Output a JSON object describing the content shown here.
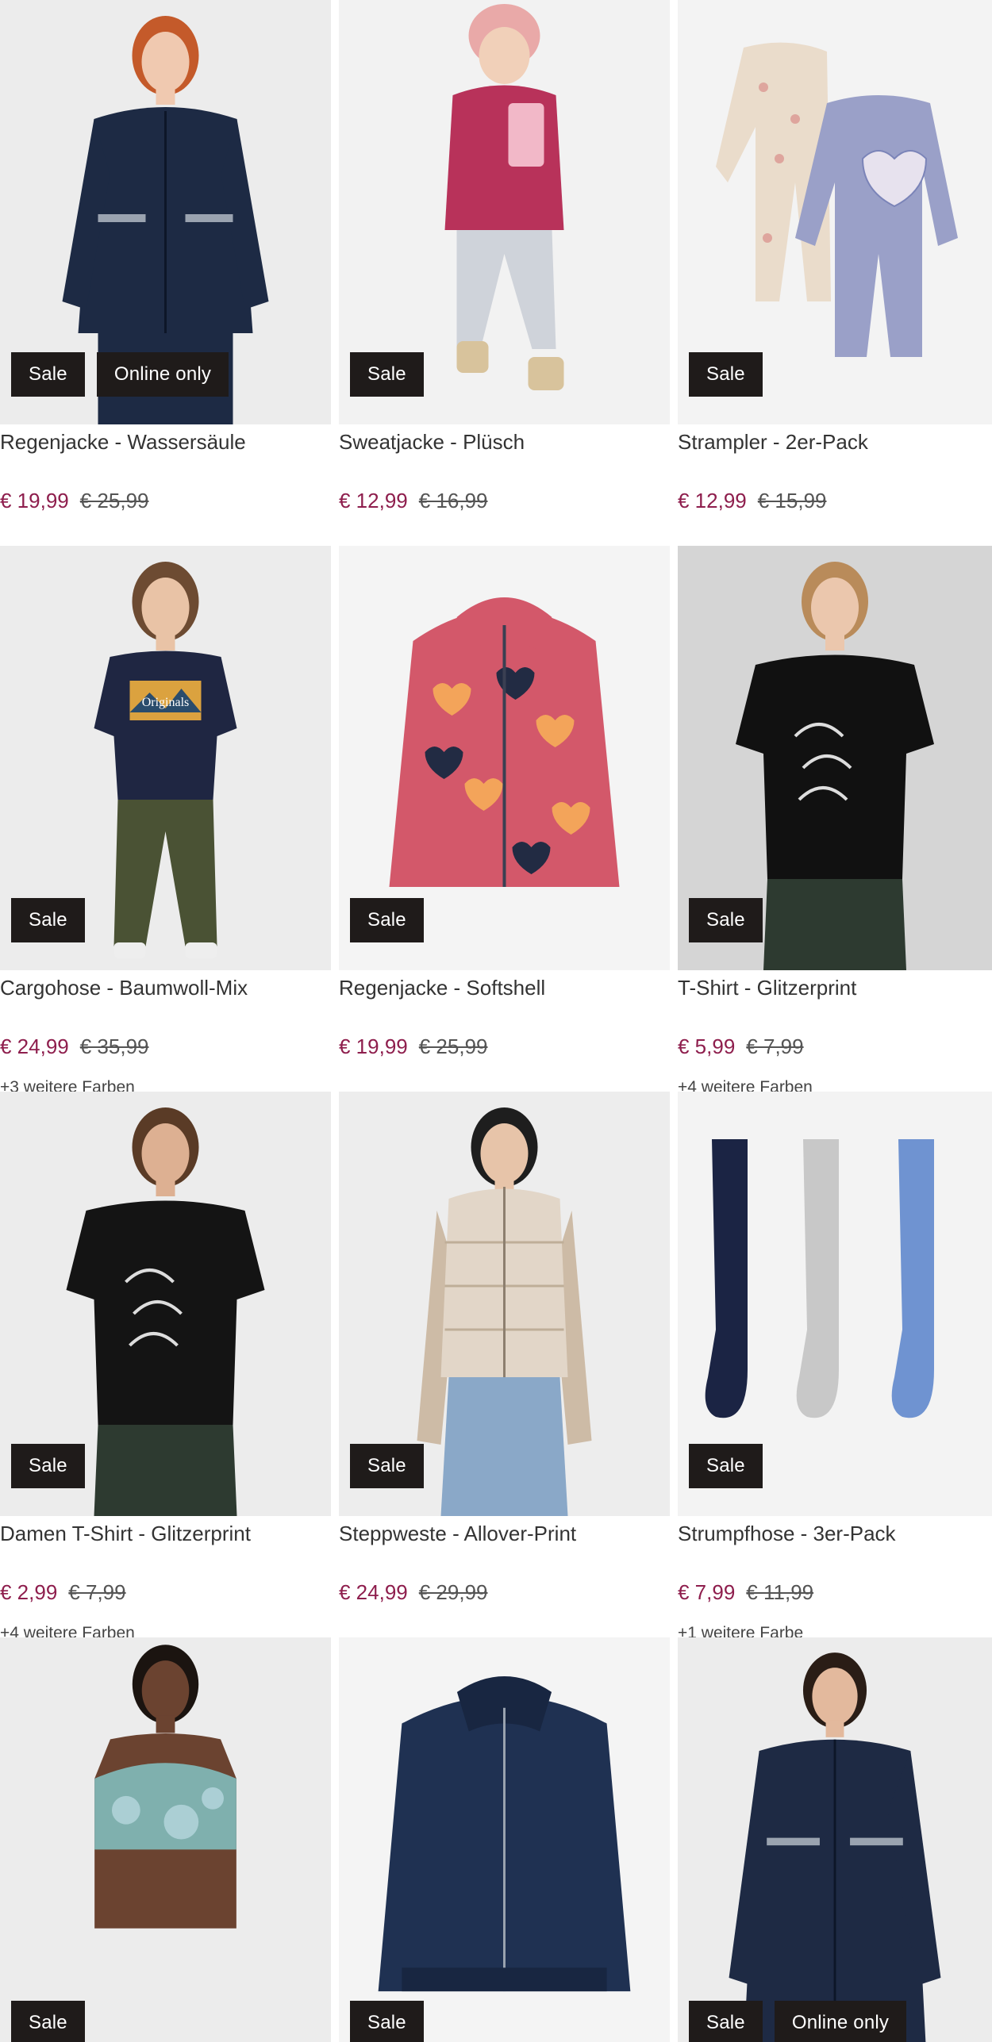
{
  "products": [
    {
      "name": "Regenjacke - Wassersäule",
      "price": "€ 19,99",
      "old_price": "€ 25,99",
      "colors": "",
      "badges": [
        "Sale",
        "Online only"
      ],
      "bg": "#ececec",
      "garment": "#1d2a44",
      "skin": "#f0c9b0",
      "hair": "#c45a2a"
    },
    {
      "name": "Sweatjacke - Plüsch",
      "price": "€ 12,99",
      "old_price": "€ 16,99",
      "colors": "",
      "badges": [
        "Sale"
      ],
      "bg": "#f2f2f2",
      "garment": "#b8325a",
      "skin": "#f1d0b9",
      "hair": "#d7a24f"
    },
    {
      "name": "Strampler - 2er-Pack",
      "price": "€ 12,99",
      "old_price": "€ 15,99",
      "colors": "",
      "badges": [
        "Sale"
      ],
      "bg": "#f3f3f3",
      "garment": "#9aa0c8",
      "skin": "#e8d7c6",
      "hair": "#e8d7c6"
    },
    {
      "name": "Cargohose - Baumwoll-Mix",
      "price": "€ 24,99",
      "old_price": "€ 35,99",
      "colors": "+3 weitere Farben",
      "badges": [
        "Sale"
      ],
      "bg": "#ececec",
      "garment": "#4a5234",
      "skin": "#e9c3a6",
      "hair": "#6d4b32"
    },
    {
      "name": "Regenjacke - Softshell",
      "price": "€ 19,99",
      "old_price": "€ 25,99",
      "colors": "",
      "badges": [
        "Sale"
      ],
      "bg": "#f4f4f4",
      "garment": "#d3586a",
      "skin": "#f3a45a",
      "hair": "#222b43"
    },
    {
      "name": "T-Shirt - Glitzerprint",
      "price": "€ 5,99",
      "old_price": "€ 7,99",
      "colors": "+4 weitere Farben",
      "badges": [
        "Sale"
      ],
      "bg": "#d5d5d5",
      "garment": "#111111",
      "skin": "#ebc7ad",
      "hair": "#b98b5a"
    },
    {
      "name": "Damen T-Shirt - Glitzerprint",
      "price": "€ 2,99",
      "old_price": "€ 7,99",
      "colors": "+4 weitere Farben",
      "badges": [
        "Sale"
      ],
      "bg": "#ececec",
      "garment": "#141414",
      "skin": "#ddb092",
      "hair": "#5a3b26"
    },
    {
      "name": "Steppweste - Allover-Print",
      "price": "€ 24,99",
      "old_price": "€ 29,99",
      "colors": "",
      "badges": [
        "Sale"
      ],
      "bg": "#ededed",
      "garment": "#e2d6c8",
      "skin": "#e7c4a9",
      "hair": "#1e1e1e"
    },
    {
      "name": "Strumpfhose - 3er-Pack",
      "price": "€ 7,99",
      "old_price": "€ 11,99",
      "colors": "+1 weitere Farbe",
      "badges": [
        "Sale"
      ],
      "bg": "#f3f3f3",
      "garment": "#1b2444",
      "skin": "#c8c8c8",
      "hair": "#6f93d1"
    },
    {
      "name": "",
      "price": "",
      "old_price": "",
      "colors": "",
      "badges": [
        "Sale"
      ],
      "bg": "#ececec",
      "garment": "#7fb0ae",
      "skin": "#6b4330",
      "hair": "#1b1410"
    },
    {
      "name": "",
      "price": "",
      "old_price": "",
      "colors": "",
      "badges": [
        "Sale"
      ],
      "bg": "#f4f4f4",
      "garment": "#1f3152",
      "skin": "#1f3152",
      "hair": "#1f3152"
    },
    {
      "name": "",
      "price": "",
      "old_price": "",
      "colors": "",
      "badges": [
        "Sale",
        "Online only"
      ],
      "bg": "#ececec",
      "garment": "#1e2a44",
      "skin": "#e3b99d",
      "hair": "#2a1d16"
    }
  ],
  "theme": {
    "price_color": "#8e1e4d",
    "badge_bg": "#1f1b1a",
    "badge_text": "#ffffff"
  }
}
